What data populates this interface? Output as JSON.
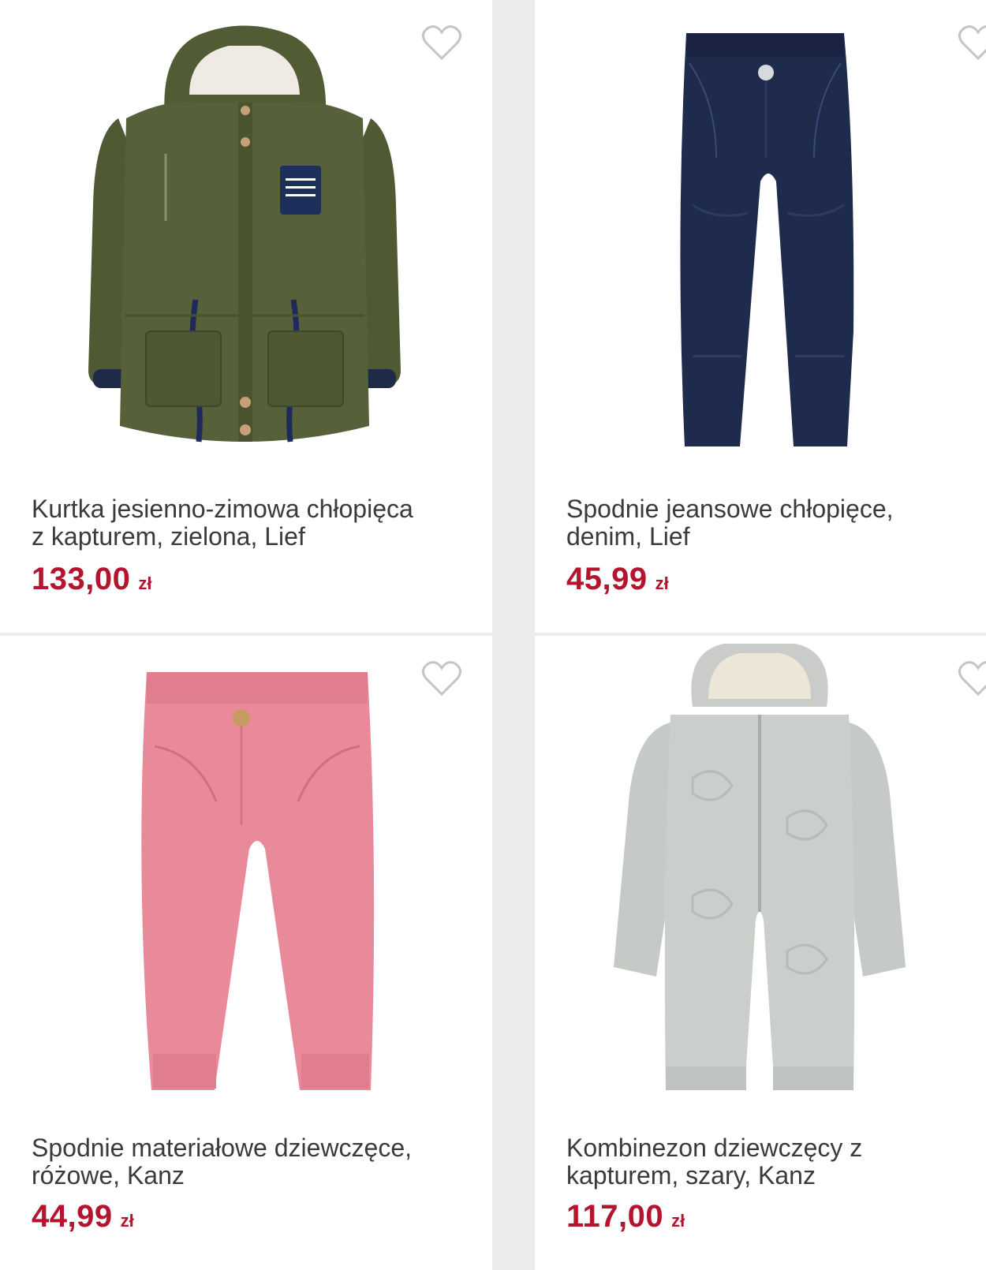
{
  "colors": {
    "price": "#b5142f",
    "title": "#3a3a3a",
    "card_bg": "#ffffff",
    "page_bg": "#ececec",
    "favorite_icon": "#c4c4c4"
  },
  "products": [
    {
      "title_line1": "Kurtka jesienno-zimowa chłopięca",
      "title_line2": "z kapturem, zielona, Lief",
      "price": "133,00",
      "currency": "zł",
      "image": "green-parka-jacket-image"
    },
    {
      "title_line1": "Spodnie jeansowe chłopięce,",
      "title_line2": "denim, Lief",
      "price": "45,99",
      "currency": "zł",
      "image": "navy-jeans-image"
    },
    {
      "title_line1": "Spodnie materiałowe dziewczęce,",
      "title_line2": "różowe, Kanz",
      "price": "44,99",
      "currency": "zł",
      "image": "pink-corduroy-trousers-image"
    },
    {
      "title_line1": "Kombinezon dziewczęcy z",
      "title_line2": "kapturem, szary, Kanz",
      "price": "117,00",
      "currency": "zł",
      "image": "grey-hooded-snowsuit-image"
    }
  ]
}
